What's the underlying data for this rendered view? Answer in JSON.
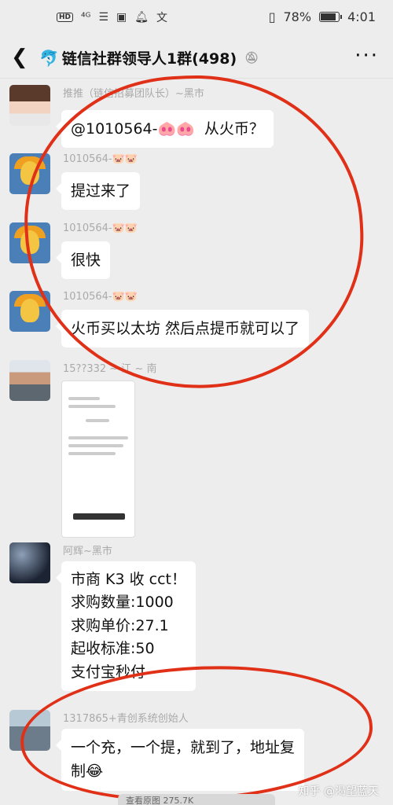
{
  "status": {
    "network": "⁴ᴳ",
    "battery": "78%",
    "battery_level": 0.78,
    "time": "4:01"
  },
  "header": {
    "title": "链信社群领导人1群(498)"
  },
  "messages": [
    {
      "name": "推推（链信招募团队长）~黑市",
      "text": "@1010564-",
      "pig": "🐽🐽",
      "tail": "从火币？"
    },
    {
      "name": "1010564-🐷🐷",
      "text": "提过来了"
    },
    {
      "name": "1010564-🐷🐷",
      "text": "很快"
    },
    {
      "name": "1010564-🐷🐷",
      "text": "火币买以太坊 然后点提币就可以了"
    },
    {
      "name": "15??332 ~ 江 ~ 南"
    },
    {
      "name": "阿辉~黑市",
      "lines": [
        "市商 K3 收 cct！",
        "求购数量:1000",
        "求购单价:27.1",
        "起收标准:50",
        "支付宝秒付"
      ]
    },
    {
      "name": "1317865+青创系统创始人",
      "lines": [
        "一个充，一个提，就到了，地址复",
        "制😂"
      ]
    }
  ],
  "watermark": "知乎 @渴望蓝天",
  "bottom_strip": "查看原图 275.7K"
}
